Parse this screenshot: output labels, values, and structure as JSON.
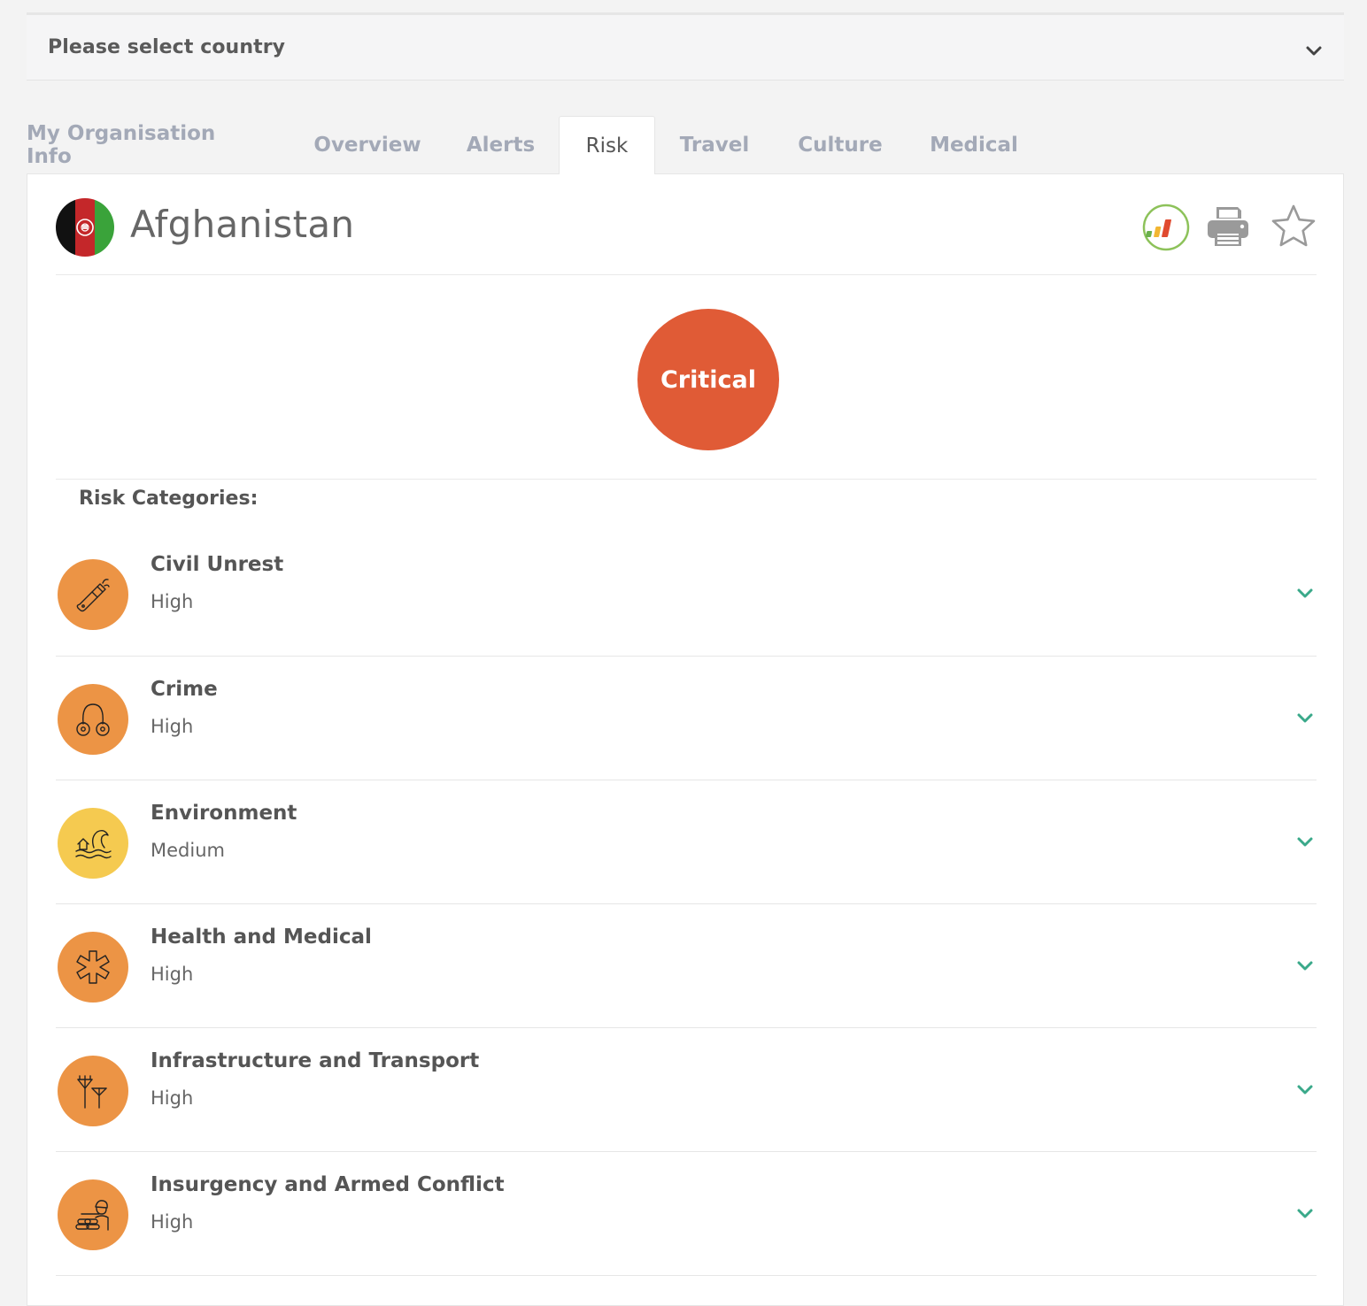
{
  "country_select": {
    "placeholder": "Please select country",
    "icon": "chevron-down-icon"
  },
  "tabs": [
    {
      "label": "My Organisation Info",
      "active": false
    },
    {
      "label": "Overview",
      "active": false
    },
    {
      "label": "Alerts",
      "active": false
    },
    {
      "label": "Risk",
      "active": true
    },
    {
      "label": "Travel",
      "active": false
    },
    {
      "label": "Culture",
      "active": false
    },
    {
      "label": "Medical",
      "active": false
    }
  ],
  "country": {
    "name": "Afghanistan",
    "flag_icon": "afghanistan-flag-icon"
  },
  "header_actions": {
    "chart_icon": "risk-chart-icon",
    "print_icon": "printer-icon",
    "favorite_icon": "star-icon"
  },
  "overall_risk": {
    "label": "Critical",
    "color": "#e05b36"
  },
  "categories_title": "Risk Categories:",
  "categories": [
    {
      "name": "Civil Unrest",
      "level": "High",
      "icon": "molotov-icon",
      "color": "#ec9445"
    },
    {
      "name": "Crime",
      "level": "High",
      "icon": "handcuffs-icon",
      "color": "#ec9445"
    },
    {
      "name": "Environment",
      "level": "Medium",
      "icon": "flood-icon",
      "color": "#f5ca50"
    },
    {
      "name": "Health and Medical",
      "level": "High",
      "icon": "medical-cross-icon",
      "color": "#ec9445"
    },
    {
      "name": "Infrastructure and Transport",
      "level": "High",
      "icon": "power-pylon-icon",
      "color": "#ec9445"
    },
    {
      "name": "Insurgency and Armed Conflict",
      "level": "High",
      "icon": "soldier-icon",
      "color": "#ec9445"
    }
  ],
  "colors": {
    "accent_chevron": "#3aa98a",
    "tab_inactive": "#a3a9b7"
  }
}
